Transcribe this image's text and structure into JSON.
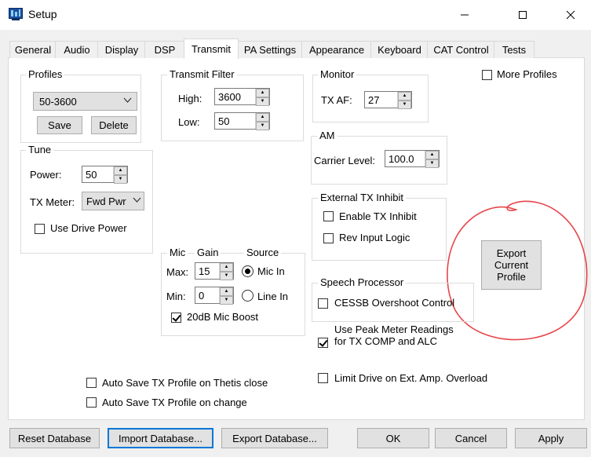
{
  "window": {
    "title": "Setup"
  },
  "tabs": [
    "General",
    "Audio",
    "Display",
    "DSP",
    "Transmit",
    "PA Settings",
    "Appearance",
    "Keyboard",
    "CAT Control",
    "Tests"
  ],
  "profiles": {
    "title": "Profiles",
    "selected": "50-3600",
    "save": "Save",
    "delete": "Delete"
  },
  "tune": {
    "title": "Tune",
    "power_label": "Power:",
    "power_value": "50",
    "meter_label": "TX Meter:",
    "meter_value": "Fwd Pwr",
    "use_drive": "Use Drive Power"
  },
  "transmit_filter": {
    "title": "Transmit Filter",
    "high_label": "High:",
    "high_value": "3600",
    "low_label": "Low:",
    "low_value": "50"
  },
  "monitor": {
    "title": "Monitor",
    "txaf_label": "TX AF:",
    "txaf_value": "27"
  },
  "more_profiles": "More Profiles",
  "am": {
    "title": "AM",
    "carrier_label": "Carrier Level:",
    "carrier_value": "100.0"
  },
  "ext_inhibit": {
    "title": "External TX Inhibit",
    "enable": "Enable TX Inhibit",
    "rev": "Rev Input Logic"
  },
  "export_profile": "Export Current Profile",
  "mic": {
    "title": "Mic",
    "gain": "Gain",
    "source": "Source",
    "max_label": "Max:",
    "max_value": "15",
    "min_label": "Min:",
    "min_value": "0",
    "mic_in": "Mic In",
    "line_in": "Line In",
    "boost": "20dB Mic Boost"
  },
  "speech": {
    "title": "Speech Processor",
    "cessb": "CESSB Overshoot Control"
  },
  "peak_meter": "Use Peak Meter Readings for TX COMP and ALC",
  "limit_drive": "Limit Drive on Ext. Amp. Overload",
  "autosave_close": "Auto Save TX Profile on Thetis close",
  "autosave_change": "Auto Save TX Profile on change",
  "buttons": {
    "reset": "Reset Database",
    "import": "Import Database...",
    "export": "Export Database...",
    "ok": "OK",
    "cancel": "Cancel",
    "apply": "Apply"
  }
}
